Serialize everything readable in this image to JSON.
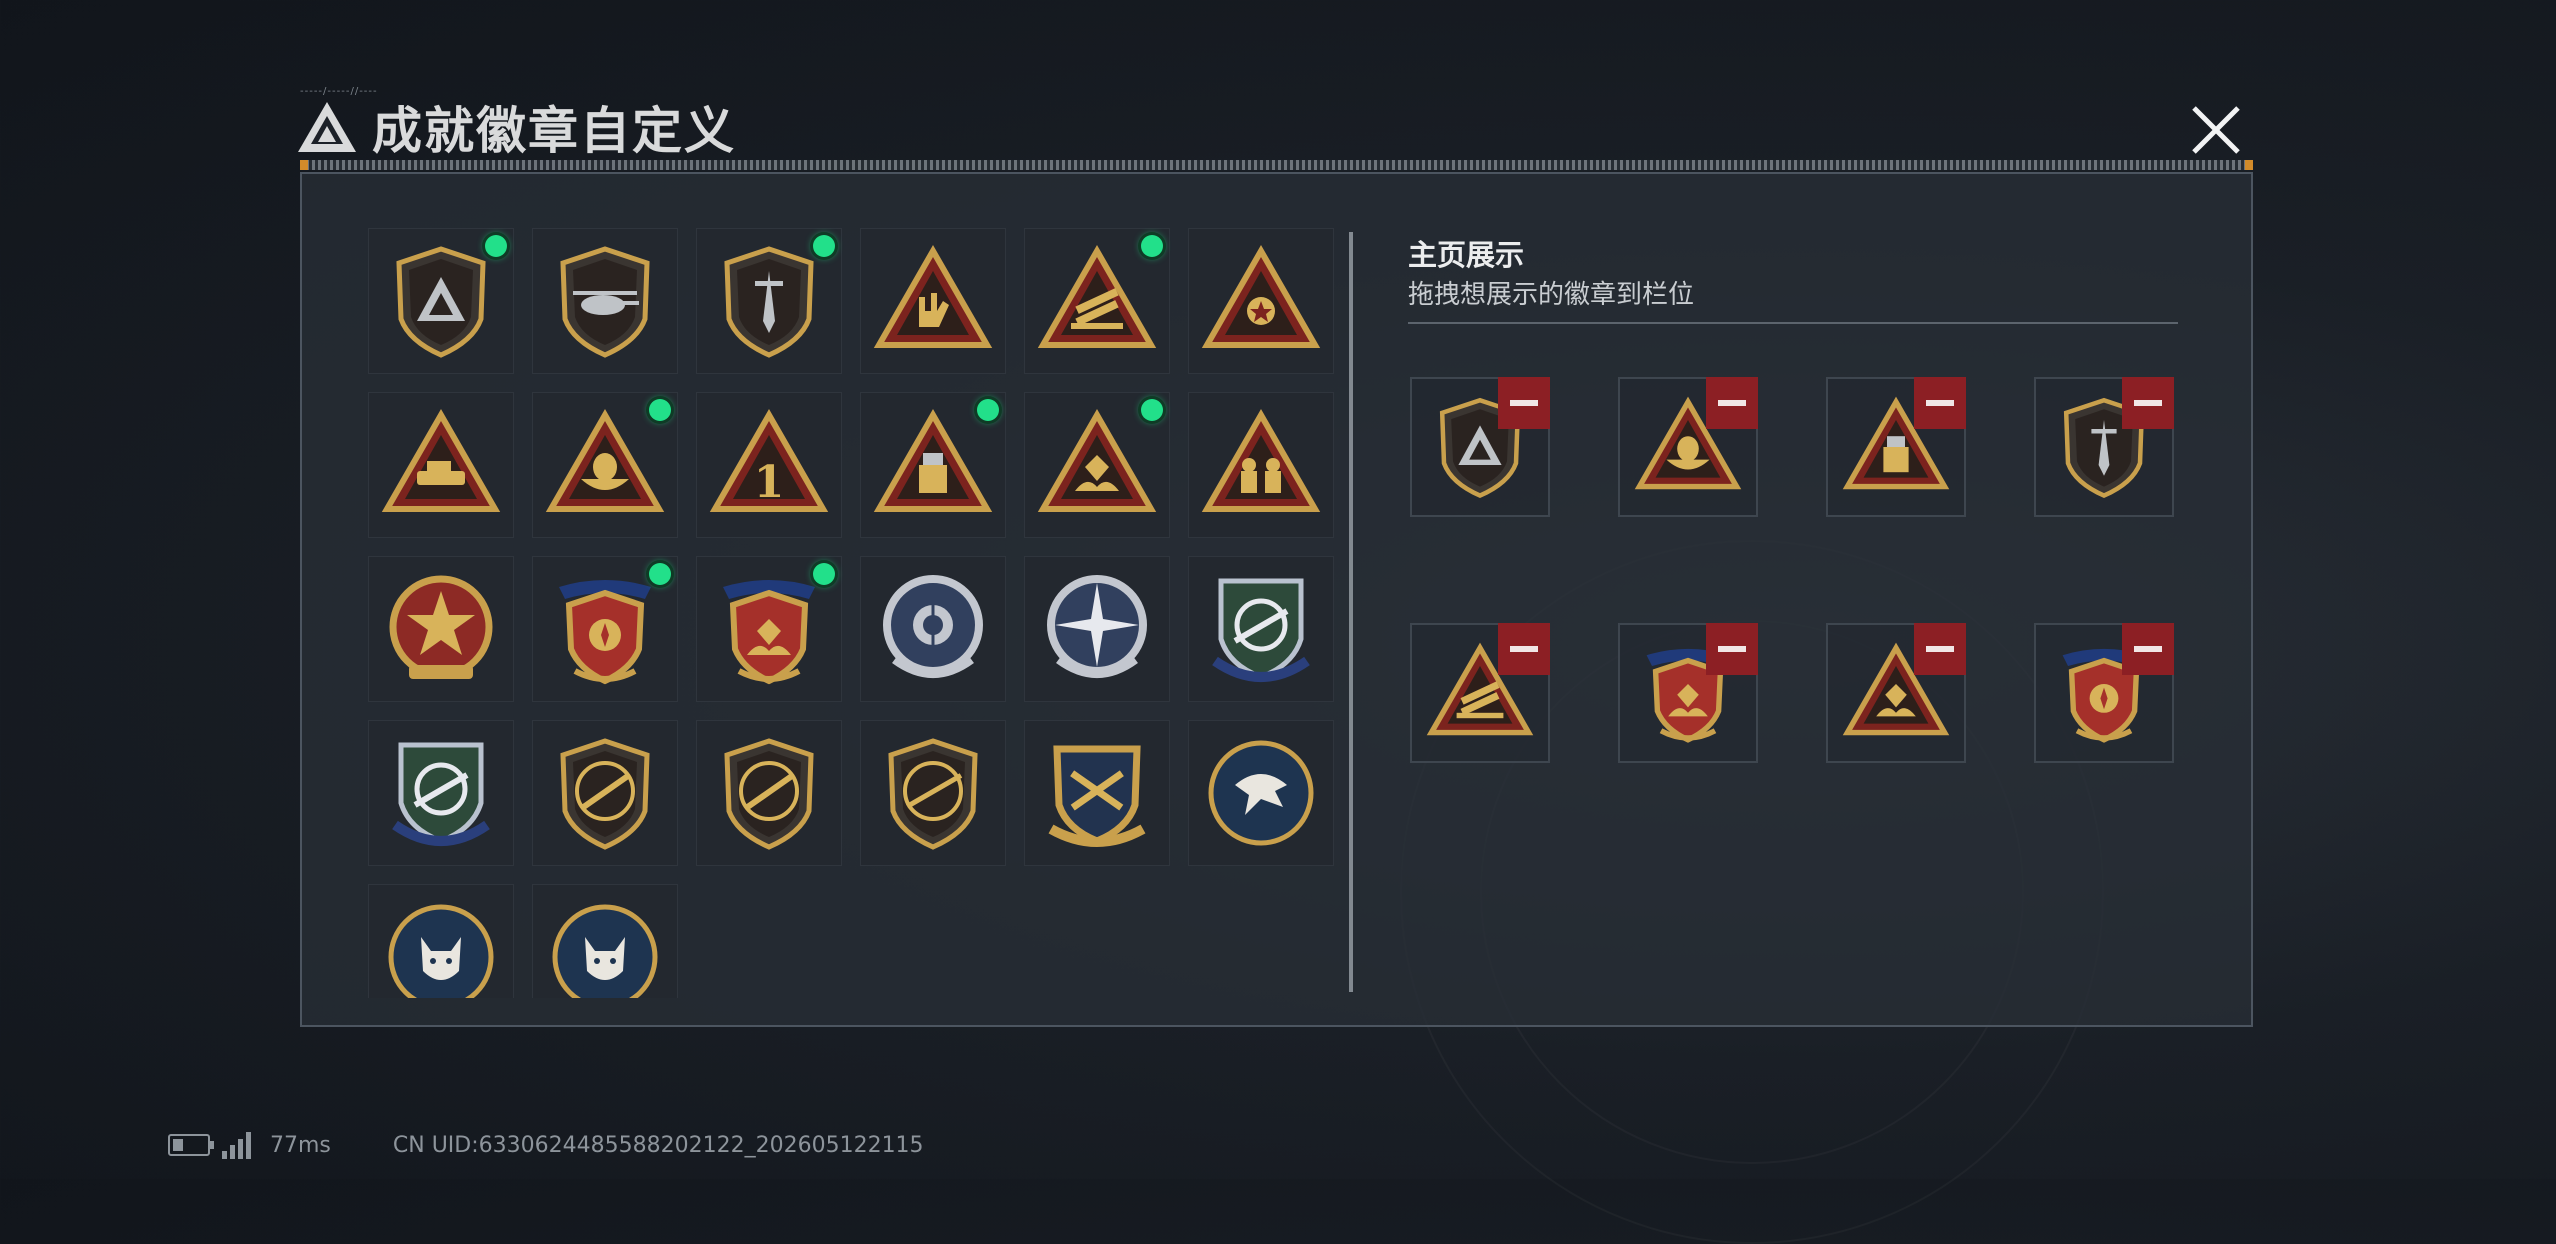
{
  "header": {
    "title": "成就徽章自定义",
    "deco_text": "-----/-----//----"
  },
  "right_panel": {
    "title": "主页展示",
    "subtitle": "拖拽想展示的徽章到栏位"
  },
  "status": {
    "ping": "77ms",
    "uid": "CN UID:6330624485588202122_202605122115"
  },
  "colors": {
    "new_dot": "#22e08a",
    "remove": "#8c1f24",
    "gold": "#c9a04c",
    "panel_bg": "#282e36"
  },
  "badges": [
    {
      "id": "b1",
      "shape": "shield",
      "icon": "triangle-logo",
      "new": true
    },
    {
      "id": "b2",
      "shape": "shield",
      "icon": "helicopter",
      "new": false
    },
    {
      "id": "b3",
      "shape": "shield",
      "icon": "dagger",
      "new": true
    },
    {
      "id": "b4",
      "shape": "triangle",
      "icon": "rock-hand",
      "new": false
    },
    {
      "id": "b5",
      "shape": "triangle",
      "icon": "missile-rack",
      "new": true
    },
    {
      "id": "b6",
      "shape": "triangle",
      "icon": "medal",
      "new": false
    },
    {
      "id": "b7",
      "shape": "triangle",
      "icon": "vehicle",
      "new": false
    },
    {
      "id": "b8",
      "shape": "triangle",
      "icon": "egg-nest",
      "new": true
    },
    {
      "id": "b9",
      "shape": "triangle",
      "icon": "number-one",
      "new": false
    },
    {
      "id": "b10",
      "shape": "triangle",
      "icon": "usb-drive",
      "new": true
    },
    {
      "id": "b11",
      "shape": "triangle",
      "icon": "hand-gem",
      "new": true
    },
    {
      "id": "b12",
      "shape": "triangle",
      "icon": "squad",
      "new": false
    },
    {
      "id": "b13",
      "shape": "round-gold",
      "icon": "star",
      "new": false
    },
    {
      "id": "b14",
      "shape": "shield-ribbon",
      "icon": "wings",
      "new": true
    },
    {
      "id": "b15",
      "shape": "shield-ribbon",
      "icon": "hand-gem",
      "new": true
    },
    {
      "id": "b16",
      "shape": "round-silver",
      "icon": "target-skull",
      "new": false
    },
    {
      "id": "b17",
      "shape": "round-silver",
      "icon": "compass-star",
      "new": false
    },
    {
      "id": "b18",
      "shape": "shield-blue",
      "icon": "crosshair-rifle",
      "new": false
    },
    {
      "id": "b19",
      "shape": "shield-blue",
      "icon": "crosshair-rifle",
      "new": false
    },
    {
      "id": "b20",
      "shape": "shield",
      "icon": "rifle",
      "new": false
    },
    {
      "id": "b21",
      "shape": "shield",
      "icon": "rifle",
      "new": false
    },
    {
      "id": "b22",
      "shape": "shield",
      "icon": "sniper",
      "new": false
    },
    {
      "id": "b23",
      "shape": "shield-gold",
      "icon": "crossed-guns",
      "new": false
    },
    {
      "id": "b24",
      "shape": "round-blue",
      "icon": "eagle",
      "new": false
    },
    {
      "id": "b25",
      "shape": "round-blue",
      "icon": "lynx",
      "new": false
    },
    {
      "id": "b26",
      "shape": "round-blue",
      "icon": "lynx",
      "new": false
    }
  ],
  "showcase": [
    {
      "id": "s1",
      "shape": "shield",
      "icon": "triangle-logo"
    },
    {
      "id": "s2",
      "shape": "triangle",
      "icon": "egg-nest"
    },
    {
      "id": "s3",
      "shape": "triangle",
      "icon": "usb-drive"
    },
    {
      "id": "s4",
      "shape": "shield",
      "icon": "dagger"
    },
    {
      "id": "s5",
      "shape": "triangle",
      "icon": "missile-rack"
    },
    {
      "id": "s6",
      "shape": "shield-ribbon",
      "icon": "hand-gem"
    },
    {
      "id": "s7",
      "shape": "triangle",
      "icon": "hand-gem"
    },
    {
      "id": "s8",
      "shape": "shield-ribbon",
      "icon": "wings"
    }
  ]
}
